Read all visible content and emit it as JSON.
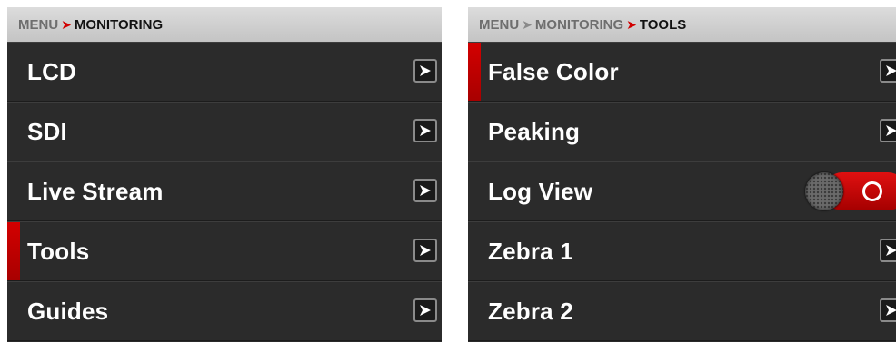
{
  "left_panel": {
    "breadcrumb": {
      "items": [
        "MENU",
        "MONITORING"
      ],
      "separator": "➤"
    },
    "rows": [
      {
        "label": "LCD",
        "control": "arrow",
        "selected": false
      },
      {
        "label": "SDI",
        "control": "arrow",
        "selected": false
      },
      {
        "label": "Live Stream",
        "control": "arrow",
        "selected": false
      },
      {
        "label": "Tools",
        "control": "arrow",
        "selected": true
      },
      {
        "label": "Guides",
        "control": "arrow",
        "selected": false
      }
    ]
  },
  "right_panel": {
    "breadcrumb": {
      "items": [
        "MENU",
        "MONITORING",
        "TOOLS"
      ],
      "separator": "➤"
    },
    "rows": [
      {
        "label": "False Color",
        "control": "arrow",
        "selected": true
      },
      {
        "label": "Peaking",
        "control": "arrow",
        "selected": false
      },
      {
        "label": "Log View",
        "control": "toggle",
        "toggle_on": true,
        "selected": false
      },
      {
        "label": "Zebra 1",
        "control": "arrow",
        "selected": false
      },
      {
        "label": "Zebra 2",
        "control": "arrow",
        "selected": false
      }
    ]
  },
  "icons": {
    "row_arrow": "chevron-right-icon"
  },
  "colors": {
    "accent_red": "#d10000",
    "selection_bar": "#c00000",
    "panel_bg": "#2a2a2a",
    "header_bg": "#d0d0d0"
  }
}
